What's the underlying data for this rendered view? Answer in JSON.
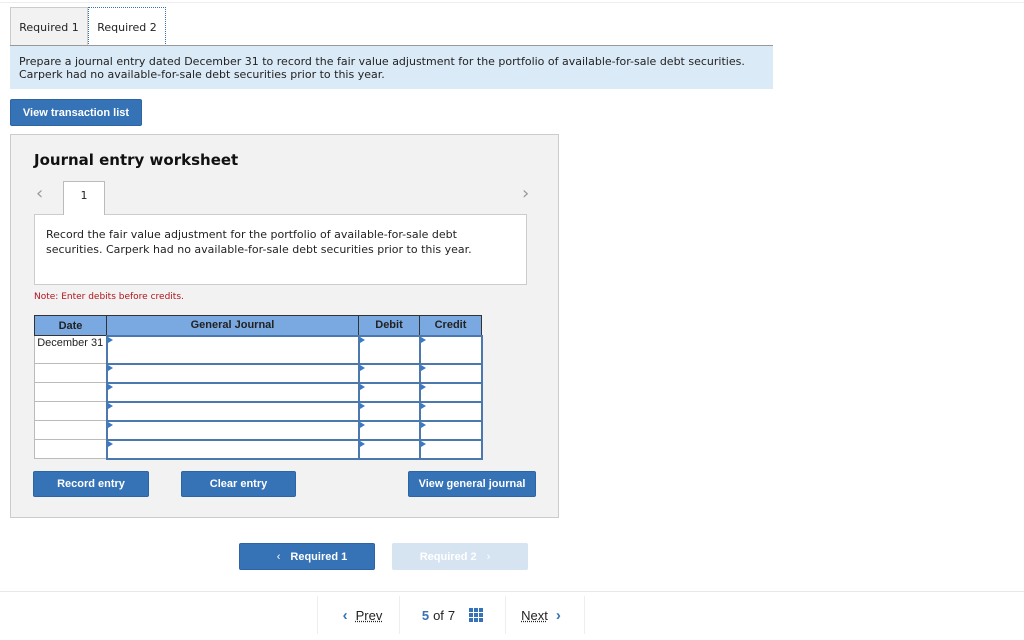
{
  "tabs": [
    {
      "label": "Required 1",
      "active": false
    },
    {
      "label": "Required 2",
      "active": true
    }
  ],
  "instructions": "Prepare a journal entry dated December 31 to record the fair value adjustment for the portfolio of available-for-sale debt securities. Carperk had no available-for-sale debt securities prior to this year.",
  "view_transaction_list": "View transaction list",
  "worksheet": {
    "title": "Journal entry worksheet",
    "prev_icon": "chevron-left-icon",
    "next_icon": "chevron-right-icon",
    "entry_tab": "1",
    "description": "Record the fair value adjustment for the portfolio of available-for-sale debt securities. Carperk had no available-for-sale debt securities prior to this year.",
    "note": "Note: Enter debits before credits.",
    "table": {
      "headers": [
        "Date",
        "General Journal",
        "Debit",
        "Credit"
      ],
      "rows": [
        {
          "date": "December 31",
          "account": "",
          "debit": "",
          "credit": ""
        },
        {
          "date": "",
          "account": "",
          "debit": "",
          "credit": ""
        },
        {
          "date": "",
          "account": "",
          "debit": "",
          "credit": ""
        },
        {
          "date": "",
          "account": "",
          "debit": "",
          "credit": ""
        },
        {
          "date": "",
          "account": "",
          "debit": "",
          "credit": ""
        },
        {
          "date": "",
          "account": "",
          "debit": "",
          "credit": ""
        }
      ]
    },
    "buttons": {
      "record": "Record entry",
      "clear": "Clear entry",
      "view_general": "View general journal"
    }
  },
  "nav": {
    "prev_required": "Required 1",
    "next_required": "Required 2"
  },
  "pager": {
    "prev": "Prev",
    "current": "5",
    "of_label": "of",
    "total": "7",
    "next": "Next"
  },
  "colors": {
    "primary": "#3572b6",
    "table_header": "#79a9e0",
    "instruction_bg": "#dbeaf7",
    "note": "#b0141c"
  }
}
